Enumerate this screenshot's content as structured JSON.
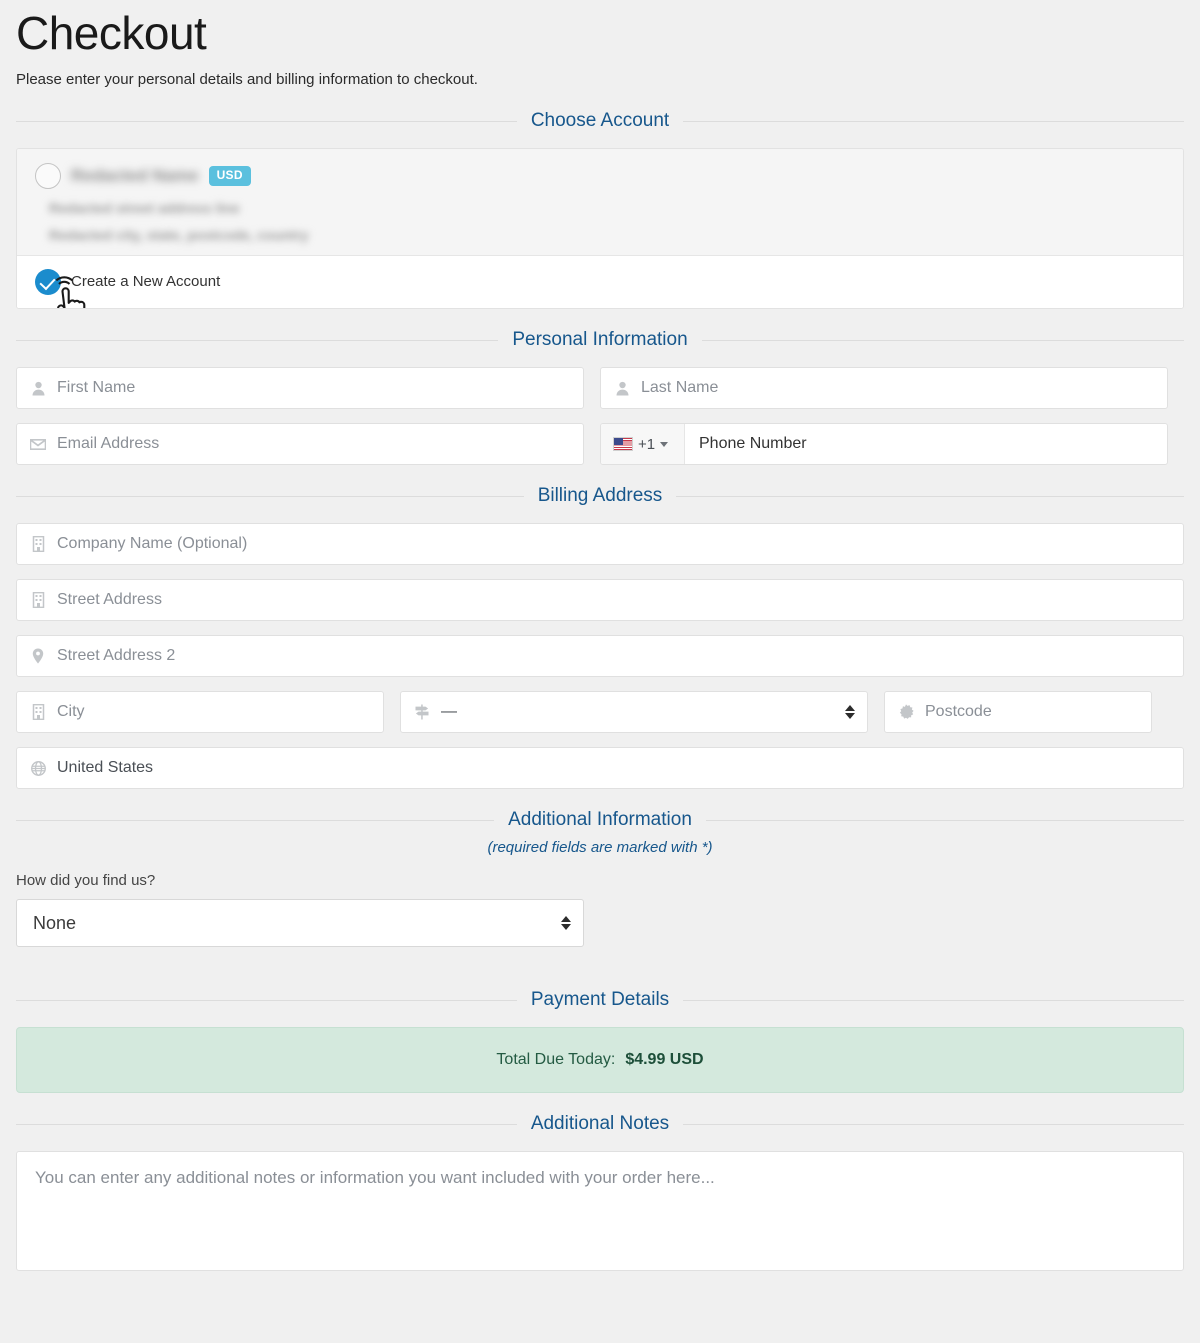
{
  "header": {
    "title": "Checkout",
    "subtitle": "Please enter your personal details and billing information to checkout."
  },
  "sections": {
    "choose_account": "Choose Account",
    "personal_information": "Personal Information",
    "billing_address": "Billing Address",
    "additional_information": "Additional Information",
    "additional_information_note": "(required fields are marked with *)",
    "payment_details": "Payment Details",
    "additional_notes": "Additional Notes"
  },
  "accounts": {
    "existing": {
      "name": "Redacted Name",
      "currency_badge": "USD",
      "address_line_1": "Redacted street address line",
      "address_line_2": "Redacted city, state, postcode, country",
      "selected": false
    },
    "new_account": {
      "label": "Create a New Account",
      "selected": true
    }
  },
  "personal": {
    "first_name": {
      "placeholder": "First Name",
      "value": "",
      "icon": "user-icon"
    },
    "last_name": {
      "placeholder": "Last Name",
      "value": "",
      "icon": "user-icon"
    },
    "email": {
      "placeholder": "Email Address",
      "value": "",
      "icon": "envelope-icon"
    },
    "phone": {
      "placeholder": "Phone Number",
      "value": "",
      "dial_code": "+1",
      "flag": "us-flag-icon"
    }
  },
  "billing": {
    "company": {
      "placeholder": "Company Name (Optional)",
      "value": "",
      "icon": "building-icon"
    },
    "street1": {
      "placeholder": "Street Address",
      "value": "",
      "icon": "building-icon"
    },
    "street2": {
      "placeholder": "Street Address 2",
      "value": "",
      "icon": "map-pin-icon"
    },
    "city": {
      "placeholder": "City",
      "value": "",
      "icon": "building-icon"
    },
    "state": {
      "value": "—",
      "icon": "signpost-icon",
      "options": [
        "—"
      ]
    },
    "postcode": {
      "placeholder": "Postcode",
      "value": "",
      "icon": "starburst-icon"
    },
    "country": {
      "value": "United States",
      "icon": "globe-icon",
      "options": [
        "United States"
      ]
    }
  },
  "additional": {
    "how_label": "How did you find us?",
    "how_value": "None",
    "how_options": [
      "None"
    ]
  },
  "payment": {
    "total_label": "Total Due Today:",
    "total_amount": "$4.99 USD"
  },
  "notes": {
    "placeholder": "You can enter any additional notes or information you want included with your order here...",
    "value": ""
  },
  "colors": {
    "legend_blue": "#17578c",
    "badge_info": "#5bc0de",
    "radio_selected": "#1b8ccd",
    "total_bg": "#d4e9dd",
    "total_text": "#1d4f39"
  }
}
